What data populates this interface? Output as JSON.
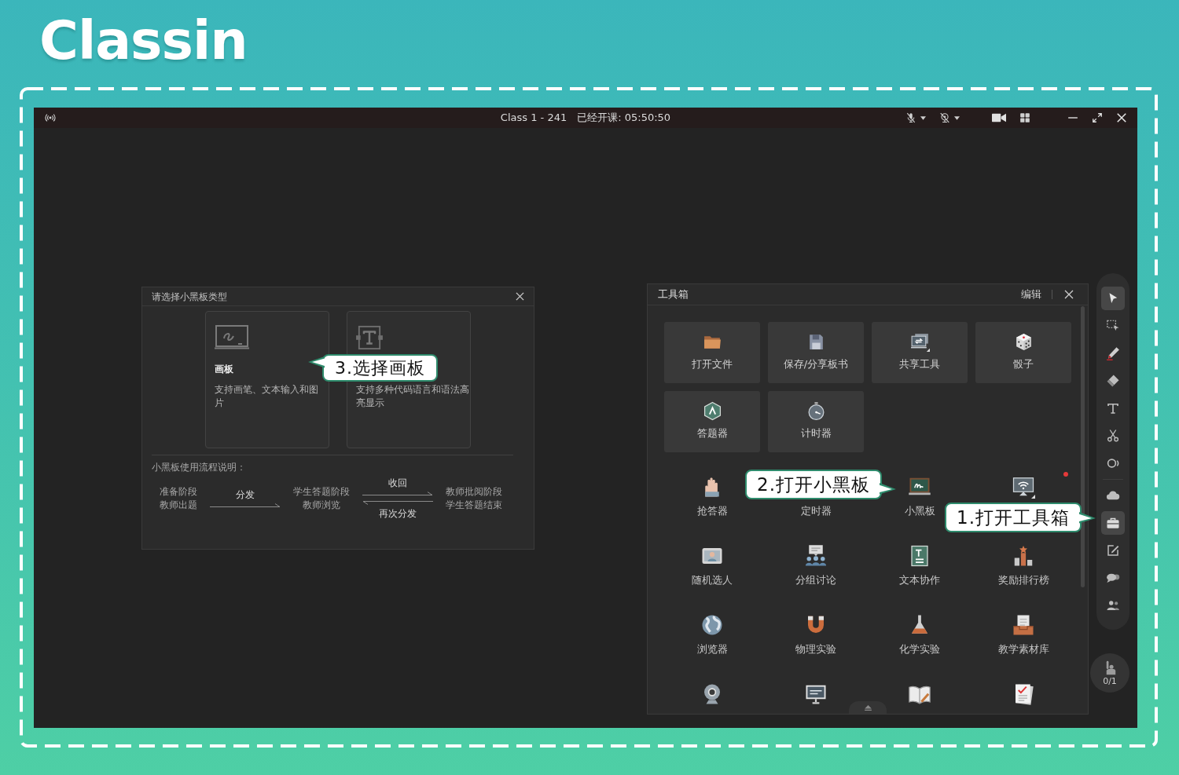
{
  "logo": {
    "text": "Classin"
  },
  "window": {
    "title": "Class 1 - 241",
    "elapsed": "已经开课: 05:50:50",
    "mic": {
      "muted": true
    },
    "camera": {
      "off": true
    }
  },
  "board_dialog": {
    "title": "请选择小黑板类型",
    "types": [
      {
        "kind": "drawing",
        "title": "画板",
        "description": "支持画笔、文本输入和图片"
      },
      {
        "kind": "code",
        "description": "支持多种代码语言和语法高亮显示"
      }
    ],
    "flow_title": "小黑板使用流程说明：",
    "flow": [
      {
        "kind": "stage",
        "lines": [
          "准备阶段",
          "教师出题"
        ]
      },
      {
        "kind": "transition",
        "arrows": [
          {
            "kind": "forward",
            "label": "分发"
          }
        ]
      },
      {
        "kind": "stage",
        "lines": [
          "学生答题阶段",
          "教师浏览"
        ]
      },
      {
        "kind": "transition",
        "arrows": [
          {
            "kind": "forward",
            "label": "收回"
          },
          {
            "kind": "back",
            "label": "再次分发"
          }
        ]
      },
      {
        "kind": "stage",
        "lines": [
          "教师批阅阶段",
          "学生答题结束"
        ]
      }
    ],
    "callout": {
      "text": "3.选择画板"
    }
  },
  "toolbox": {
    "title": "工具箱",
    "edit": "编辑",
    "pinned": [
      {
        "label": "打开文件"
      },
      {
        "label": "保存/分享板书"
      },
      {
        "label": "共享工具"
      },
      {
        "label": "骰子"
      },
      {
        "label": "答题器"
      },
      {
        "label": "计时器"
      }
    ],
    "tools": [
      {
        "label": "抢答器",
        "new": false
      },
      {
        "label": "定时器",
        "new": false
      },
      {
        "label": "小黑板",
        "new": false
      },
      {
        "new": true
      },
      {
        "label": "随机选人",
        "new": false
      },
      {
        "label": "分组讨论",
        "new": false
      },
      {
        "label": "文本协作",
        "new": false
      },
      {
        "label": "奖励排行榜",
        "new": false
      },
      {
        "label": "浏览器",
        "new": false
      },
      {
        "label": "物理实验",
        "new": false
      },
      {
        "label": "化学实验",
        "new": false
      },
      {
        "label": "教学素材库",
        "new": false
      },
      {
        "new": false
      },
      {
        "new": false
      },
      {
        "new": false
      },
      {
        "new": false
      }
    ],
    "callout": {
      "text": "2.打开小黑板"
    }
  },
  "toolbar": {
    "groups": [
      {
        "tools": [
          {
            "selected": true
          },
          {
            "selected": false
          },
          {
            "selected": false
          },
          {
            "selected": false
          },
          {
            "selected": false
          },
          {
            "selected": false
          },
          {
            "selected": false
          }
        ]
      },
      {
        "tools": [
          {
            "selected": false
          },
          {
            "selected": true
          },
          {
            "selected": false
          },
          {
            "selected": false
          },
          {
            "selected": false
          }
        ]
      }
    ],
    "hand_raise": {
      "count": "0/1"
    },
    "callout": {
      "text": "1.打开工具箱"
    }
  }
}
